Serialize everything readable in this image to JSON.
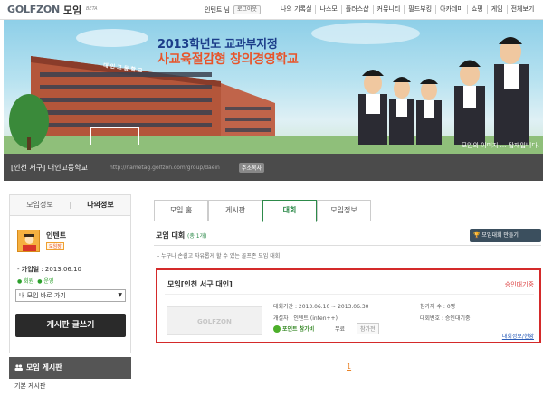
{
  "header": {
    "logo_text": "GOLFZON",
    "service_name": "모임",
    "beta_label": "BETA",
    "user_name": "인텐트 님",
    "logout_label": "로그아웃",
    "nav": [
      "나의 기록실",
      "나스모",
      "플러스샵",
      "커뮤니티",
      "필드부킹",
      "아카데미",
      "쇼핑",
      "게임",
      "전체보기"
    ]
  },
  "banner": {
    "title_line1": "2013학년도 교과부지정",
    "title_line2": "사교육절감형 창의경영학교",
    "school_sign": "대 인 고 등 학 교",
    "caption": "모임의 이미지 ... 탑재입니다."
  },
  "group": {
    "name": "[인천 서구] 대인고등학교",
    "url": "http://nametag.golfzon.com/group/daein",
    "copy_url_label": "주소복사"
  },
  "sidebar": {
    "tabs": [
      "모임정보",
      "나의정보"
    ],
    "profile": {
      "name": "인텐트",
      "badge": "모임장",
      "joined_label": "가입일",
      "joined_value": "2013.06.10",
      "badge_items": [
        "● 회원",
        "● 운영"
      ]
    },
    "goto_select": "내 모임 바로 가기",
    "write_button": "게시판 글쓰기",
    "board_title": "모임 게시판",
    "board_items": [
      "기본 게시판"
    ]
  },
  "main": {
    "tabs": [
      "모임 홈",
      "게시판",
      "대회",
      "모임정보"
    ],
    "selected_tab": "대회",
    "section_title": "모임 대회",
    "section_count": "(총 1개)",
    "create_button": "모임대회 만들기",
    "description": "- 누구나 손쉽고 자유롭게 할 수 있는 골프존 모임 대회",
    "card": {
      "title": "모임[인천 서구 대인]",
      "status": "승인대기중",
      "thumb_logo": "GOLFZON",
      "period": "대회기간 : 2013.06.10 ~ 2013.06.30",
      "host": "개설자 : 인텐트 (inten++)",
      "participants": "참가자 수 : 0명",
      "number": "대회번호 : 승인대기중",
      "fee_label": "포인트 참가비",
      "fee_value": "무료",
      "join_button": "참가전",
      "detail_link": "대회정보/현황"
    },
    "pagination": [
      "1"
    ]
  },
  "colors": {
    "accent_green": "#2d8a4a",
    "highlight_red": "#d42a2a",
    "dark_bar": "#4b4b4b",
    "orange": "#e8842a"
  }
}
